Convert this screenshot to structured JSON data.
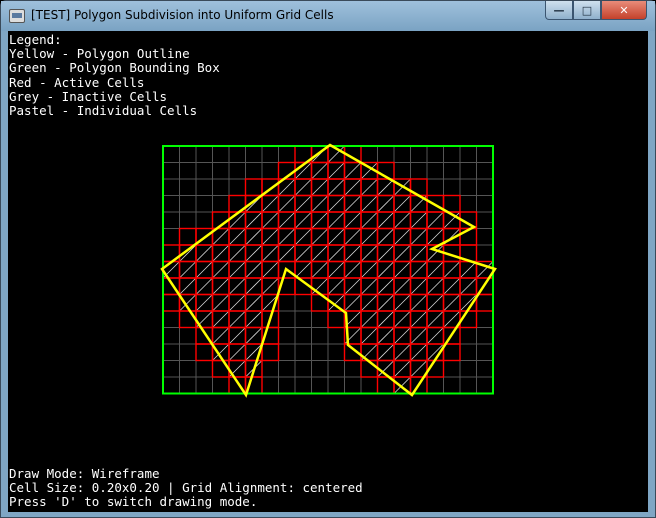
{
  "window": {
    "title": "[TEST] Polygon Subdivision into Uniform Grid Cells",
    "controls": {
      "minimize": "—",
      "maximize": "□",
      "close": "✕"
    }
  },
  "legend": {
    "heading": "Legend:",
    "lines": [
      "Yellow - Polygon Outline",
      "Green - Polygon Bounding Box",
      "Red - Active Cells",
      "Grey - Inactive Cells",
      "Pastel - Individual Cells"
    ]
  },
  "status": {
    "draw_mode": "Draw Mode: Wireframe",
    "cell_info": "Cell Size: 0.20x0.20 | Grid Alignment: centered",
    "hint": "Press 'D' to switch drawing mode."
  },
  "colors": {
    "background": "#000000",
    "polygon_outline": "#ffff00",
    "bounding_box": "#00ff00",
    "active_cell": "#ff0000",
    "inactive_cell": "#555555",
    "individual_cell": "#ffffff",
    "text": "#ffffff"
  },
  "icons": {
    "app": "app-window-icon",
    "minimize": "minimize-icon",
    "maximize": "maximize-icon",
    "close": "close-icon"
  }
}
